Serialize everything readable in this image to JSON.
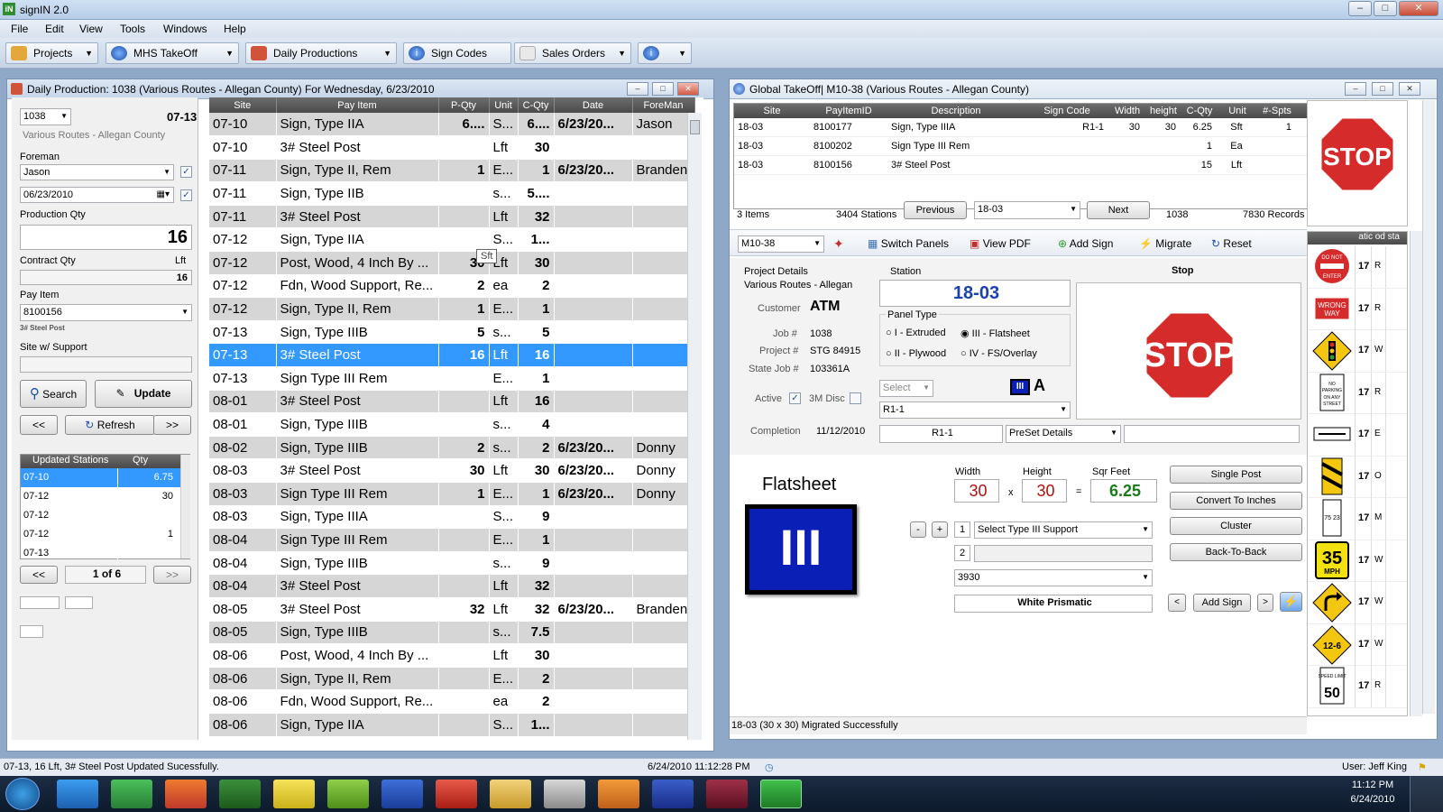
{
  "app": {
    "title": "signIN 2.0",
    "icon": "iN"
  },
  "menu": [
    "File",
    "Edit",
    "View",
    "Tools",
    "Windows",
    "Help"
  ],
  "toolbar": [
    {
      "label": "Projects",
      "icon": "folders-icon"
    },
    {
      "label": "MHS TakeOff",
      "icon": "globe-icon"
    },
    {
      "label": "Daily Productions",
      "icon": "calendar-icon"
    },
    {
      "label": "Sign Codes",
      "icon": "info-icon"
    },
    {
      "label": "Sales Orders",
      "icon": "pen-icon"
    },
    {
      "label": "",
      "icon": "info-badge-icon"
    }
  ],
  "left": {
    "title": "Daily Production:  1038 (Various Routes - Allegan County) For Wednesday, 6/23/2010",
    "job": "1038",
    "station": "07-13",
    "county": "Various Routes - Allegan County",
    "foreman_label": "Foreman",
    "foreman": "Jason",
    "date": "06/23/2010",
    "prod_qty_label": "Production Qty",
    "prod_qty": "16",
    "contract_qty_label": "Contract Qty",
    "contract_unit": "Lft",
    "contract_qty": "16",
    "pay_item_label": "Pay Item",
    "pay_item": "8100156",
    "pay_item_desc": "3# Steel Post",
    "site_label": "Site w/ Support",
    "search": "Search",
    "update": "Update",
    "prev": "<<",
    "refresh": "Refresh",
    "next": ">>",
    "upd_header": "Updated Stations",
    "upd_qty_header": "Qty",
    "updated": [
      {
        "s": "07-10",
        "q": "6.75"
      },
      {
        "s": "07-12",
        "q": "30"
      },
      {
        "s": "07-12",
        "q": ""
      },
      {
        "s": "07-12",
        "q": "1"
      },
      {
        "s": "07-13",
        "q": ""
      }
    ],
    "page": "1 of 6"
  },
  "grid": {
    "headers": [
      "Site",
      "Pay Item",
      "P-Qty",
      "Unit",
      "C-Qty",
      "Date",
      "ForeMan"
    ],
    "tooltip": "Sft",
    "rows": [
      [
        "07-10",
        "Sign, Type IIA",
        "6....",
        "S...",
        "6....",
        "6/23/20...",
        "Jason"
      ],
      [
        "07-10",
        "3# Steel Post",
        "",
        "Lft",
        "30",
        "",
        ""
      ],
      [
        "07-11",
        "Sign, Type II, Rem",
        "1",
        "E...",
        "1",
        "6/23/20...",
        "Branden"
      ],
      [
        "07-11",
        "Sign, Type IIB",
        "",
        "s...",
        "5....",
        "",
        ""
      ],
      [
        "07-11",
        "3# Steel Post",
        "",
        "Lft",
        "32",
        "",
        ""
      ],
      [
        "07-12",
        "Sign, Type IIA",
        "",
        "S...",
        "1...",
        "",
        ""
      ],
      [
        "07-12",
        "Post, Wood, 4 Inch By ...",
        "30",
        "Lft",
        "30",
        "",
        ""
      ],
      [
        "07-12",
        "Fdn, Wood Support, Re...",
        "2",
        "ea",
        "2",
        "",
        ""
      ],
      [
        "07-12",
        "Sign, Type II, Rem",
        "1",
        "E...",
        "1",
        "",
        ""
      ],
      [
        "07-13",
        "Sign, Type IIIB",
        "5",
        "s...",
        "5",
        "",
        ""
      ],
      [
        "07-13",
        "3# Steel Post",
        "16",
        "Lft",
        "16",
        "",
        ""
      ],
      [
        "07-13",
        "Sign Type III Rem",
        "",
        "E...",
        "1",
        "",
        ""
      ],
      [
        "08-01",
        "3# Steel Post",
        "",
        "Lft",
        "16",
        "",
        ""
      ],
      [
        "08-01",
        "Sign, Type IIIB",
        "",
        "s...",
        "4",
        "",
        ""
      ],
      [
        "08-02",
        "Sign, Type IIIB",
        "2",
        "s...",
        "2",
        "6/23/20...",
        "Donny"
      ],
      [
        "08-03",
        "3# Steel Post",
        "30",
        "Lft",
        "30",
        "6/23/20...",
        "Donny"
      ],
      [
        "08-03",
        "Sign Type III Rem",
        "1",
        "E...",
        "1",
        "6/23/20...",
        "Donny"
      ],
      [
        "08-03",
        "Sign, Type IIIA",
        "",
        "S...",
        "9",
        "",
        ""
      ],
      [
        "08-04",
        "Sign Type III Rem",
        "",
        "E...",
        "1",
        "",
        ""
      ],
      [
        "08-04",
        "Sign, Type IIIB",
        "",
        "s...",
        "9",
        "",
        ""
      ],
      [
        "08-04",
        "3# Steel Post",
        "",
        "Lft",
        "32",
        "",
        ""
      ],
      [
        "08-05",
        "3# Steel Post",
        "32",
        "Lft",
        "32",
        "6/23/20...",
        "Branden"
      ],
      [
        "08-05",
        "Sign, Type IIIB",
        "",
        "s...",
        "7.5",
        "",
        ""
      ],
      [
        "08-06",
        "Post, Wood, 4 Inch By ...",
        "",
        "Lft",
        "30",
        "",
        ""
      ],
      [
        "08-06",
        "Sign, Type II, Rem",
        "",
        "E...",
        "2",
        "",
        ""
      ],
      [
        "08-06",
        "Fdn, Wood Support, Re...",
        "",
        "ea",
        "2",
        "",
        ""
      ],
      [
        "08-06",
        "Sign, Type IIA",
        "",
        "S...",
        "1...",
        "",
        ""
      ]
    ]
  },
  "right": {
    "title": "Global TakeOff| M10-38  (Various Routes - Allegan County)",
    "headers": [
      "Site",
      "PayItemID",
      "Description",
      "Sign Code",
      "Width",
      "height",
      "C-Qty",
      "Unit",
      "#-Spts"
    ],
    "rows": [
      [
        "18-03",
        "8100177",
        "Sign, Type IIIA",
        "R1-1",
        "30",
        "30",
        "6.25",
        "Sft",
        "1"
      ],
      [
        "18-03",
        "8100202",
        "Sign Type III Rem",
        "",
        "",
        "",
        "1",
        "Ea",
        ""
      ],
      [
        "18-03",
        "8100156",
        "3# Steel Post",
        "",
        "",
        "",
        "15",
        "Lft",
        ""
      ]
    ],
    "items": "3 Items",
    "stations": "3404 Stations",
    "previous": "Previous",
    "station_sel": "18-03",
    "next": "Next",
    "job": "1038",
    "records": "7830 Records",
    "route": "M10-38",
    "switch": "Switch Panels",
    "pdf": "View PDF",
    "addsign": "Add Sign",
    "migrate": "Migrate",
    "reset": "Reset",
    "pd_label": "Project Details",
    "pd_county": "Various Routes - Allegan",
    "customer_label": "Customer",
    "customer": "ATM",
    "job_label": "Job #",
    "job_no": "1038",
    "project_label": "Project #",
    "project": "STG 84915",
    "statejob_label": "State Job #",
    "statejob": "103361A",
    "active_label": "Active",
    "disc_label": "3M Disc",
    "completion_label": "Completion",
    "completion": "11/12/2010",
    "station_label": "Station",
    "station_val": "18-03",
    "panel_label": "Panel Type",
    "panel_opts": [
      "I - Extruded",
      "III - Flatsheet",
      "II - Plywood",
      "IV - FS/Overlay"
    ],
    "select_ph": "Select",
    "grade": "A",
    "code_sel": "R1-1",
    "code_box": "R1-1",
    "preset": "PreSet Details",
    "sign_name": "Stop",
    "stop_text": "STOP",
    "flatsheet": "Flatsheet",
    "roman": "III",
    "width_label": "Width",
    "height_label": "Height",
    "sqft_label": "Sqr Feet",
    "width": "30",
    "height": "30",
    "sqft": "6.25",
    "x": "x",
    "eq": "=",
    "support_sel": "Select Type III Support",
    "support_no1": "1",
    "support_no2": "2",
    "material": "3930",
    "sheeting": "White Prismatic",
    "single": "Single Post",
    "convert": "Convert To Inches",
    "cluster": "Cluster",
    "b2b": "Back-To-Back",
    "add_sign2": "Add Sign",
    "status": "18-03 (30 x 30)  Migrated Successfully",
    "side_header": "atic od sta",
    "side_rows": [
      {
        "q": "17",
        "c": "R",
        "sign": "do-not-enter",
        "t": "DO NOT ENTER"
      },
      {
        "q": "17",
        "c": "R",
        "sign": "wrong-way",
        "t": "WRONG WAY"
      },
      {
        "q": "17",
        "c": "W",
        "sign": "signal-ahead",
        "t": ""
      },
      {
        "q": "17",
        "c": "R",
        "sign": "no-parking",
        "t": "NO PARKING ON ANY STREET"
      },
      {
        "q": "17",
        "c": "E",
        "sign": "arrow-plate",
        "t": ""
      },
      {
        "q": "17",
        "c": "O",
        "sign": "hazard-marker",
        "t": ""
      },
      {
        "q": "17",
        "c": "M",
        "sign": "route-marker",
        "t": "75 23"
      },
      {
        "q": "17",
        "c": "W",
        "sign": "speed-35",
        "t": "35",
        "t2": "MPH"
      },
      {
        "q": "17",
        "c": "W",
        "sign": "turn-arrow",
        "t": ""
      },
      {
        "q": "17",
        "c": "W",
        "sign": "clearance",
        "t": "12-6"
      },
      {
        "q": "17",
        "c": "R",
        "sign": "speed-limit",
        "t": "50",
        "t2": "SPEED LIMIT"
      }
    ]
  },
  "status": {
    "message": "07-13, 16 Lft,  3# Steel Post Updated Sucessfully.",
    "datetime": "6/24/2010 11:12:28 PM",
    "user": "User:  Jeff King"
  },
  "taskbar": {
    "time": "11:12 PM",
    "date": "6/24/2010"
  },
  "colors": {
    "selection": "#3399ff",
    "stop_red": "#d52b2b",
    "panel_blue": "#0a1fb5"
  }
}
